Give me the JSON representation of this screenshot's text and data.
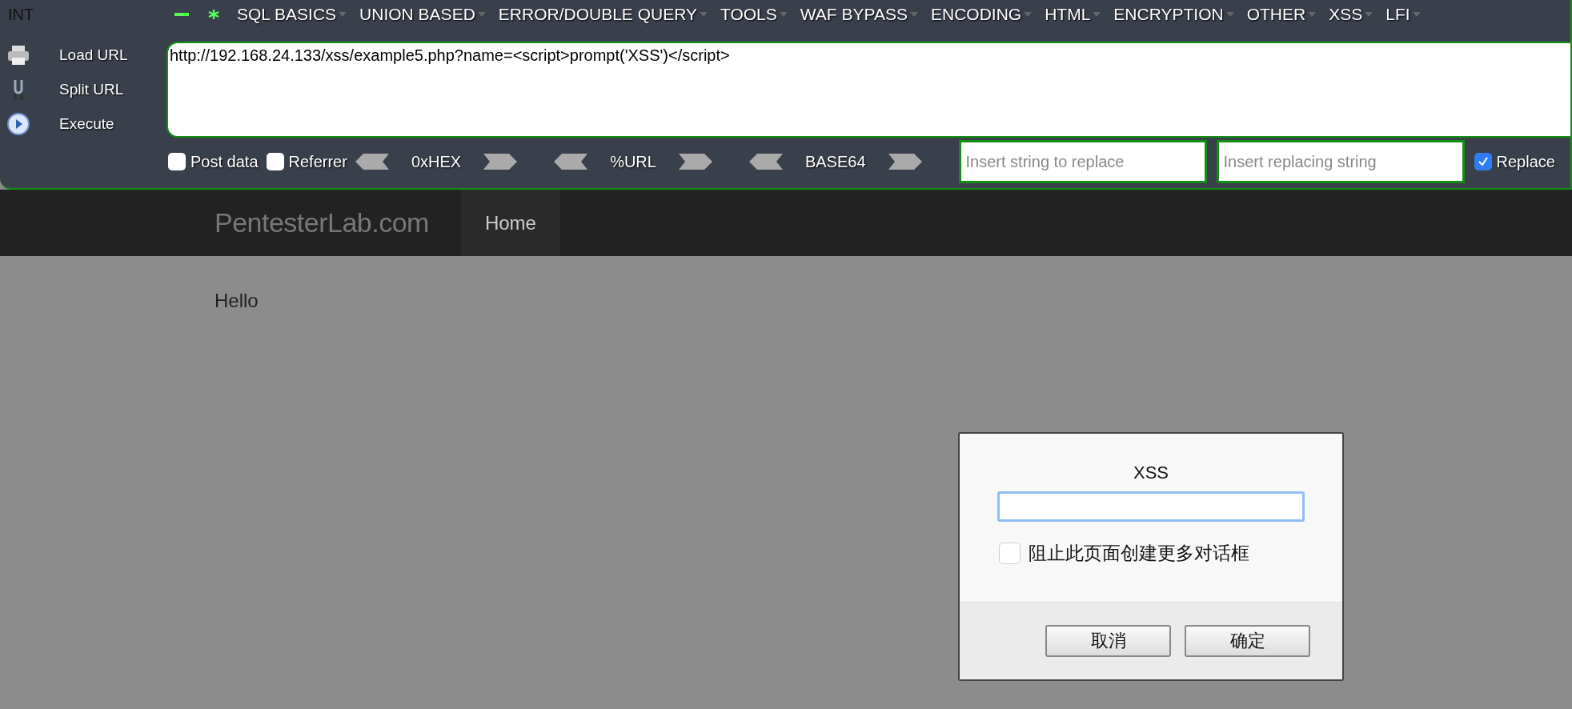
{
  "toolbar": {
    "title": "INT",
    "menus": [
      {
        "label": "SQL BASICS"
      },
      {
        "label": "UNION BASED"
      },
      {
        "label": "ERROR/DOUBLE QUERY"
      },
      {
        "label": "TOOLS"
      },
      {
        "label": "WAF BYPASS"
      },
      {
        "label": "ENCODING"
      },
      {
        "label": "HTML"
      },
      {
        "label": "ENCRYPTION"
      },
      {
        "label": "OTHER"
      },
      {
        "label": "XSS"
      },
      {
        "label": "LFI"
      }
    ],
    "actions": [
      {
        "kind": "load",
        "label": "Load URL"
      },
      {
        "kind": "split",
        "label": "Split URL"
      },
      {
        "kind": "execute",
        "label": "Execute"
      }
    ],
    "url": "http://192.168.24.133/xss/example5.php?name=<script>prompt('XSS')</script>",
    "options": [
      {
        "label": "Post data",
        "checked": false
      },
      {
        "label": "Referrer",
        "checked": false
      }
    ],
    "encoders": [
      {
        "label": "0xHEX"
      },
      {
        "label": "%URL"
      },
      {
        "label": "BASE64"
      }
    ],
    "replace_fields": [
      {
        "placeholder": "Insert string to replace"
      },
      {
        "placeholder": "Insert replacing string"
      }
    ],
    "replace": {
      "label": "Replace",
      "checked": true
    }
  },
  "site": {
    "brand": "PentesterLab.com",
    "nav": [
      {
        "label": "Home",
        "selected": true
      }
    ],
    "content": "Hello"
  },
  "dialog": {
    "title": "XSS",
    "checkbox": {
      "label": "阻止此页面创建更多对话框",
      "checked": false
    },
    "buttons": [
      "取消",
      "确定"
    ]
  }
}
